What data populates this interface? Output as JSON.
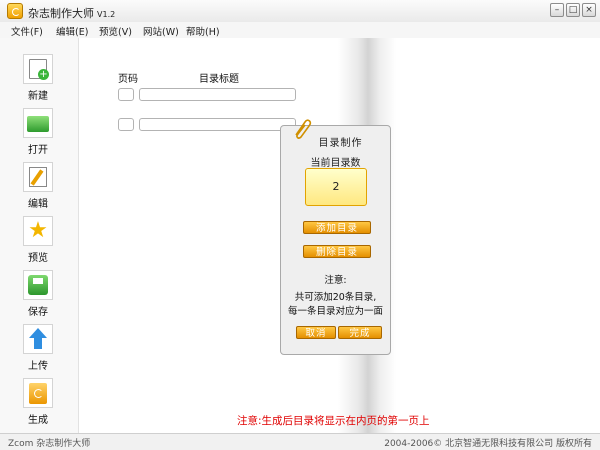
{
  "window": {
    "title": "杂志制作大师",
    "version": "V1.2",
    "minimize": "–",
    "maximize": "□",
    "close": "×"
  },
  "menu": [
    {
      "label": "文件",
      "key": "(F)"
    },
    {
      "label": "编辑",
      "key": "(E)"
    },
    {
      "label": "预览",
      "key": "(V)"
    },
    {
      "label": "网站",
      "key": "(W)"
    },
    {
      "label": "帮助",
      "key": "(H)"
    }
  ],
  "sidebar": [
    {
      "label": "新建",
      "icon": "new-document-icon"
    },
    {
      "label": "打开",
      "icon": "open-folder-icon"
    },
    {
      "label": "编辑",
      "icon": "edit-icon"
    },
    {
      "label": "预览",
      "icon": "preview-star-icon"
    },
    {
      "label": "保存",
      "icon": "save-icon"
    },
    {
      "label": "上传",
      "icon": "upload-arrow-icon"
    },
    {
      "label": "生成",
      "icon": "generate-book-icon"
    }
  ],
  "toc_form": {
    "page_header": "页码",
    "title_header": "目录标题",
    "rows": [
      {
        "page": "",
        "title": ""
      },
      {
        "page": "",
        "title": ""
      }
    ]
  },
  "panel": {
    "title": "目录制作",
    "current_label": "当前目录数",
    "count": "2",
    "add_button": "添加目录",
    "delete_button": "删除目录",
    "note_title": "注意:",
    "note_line1": "共可添加20条目录,",
    "note_line2": "每一条目录对应为一面",
    "cancel_button": "取消",
    "done_button": "完成"
  },
  "notice": "注意:生成后目录将显示在内页的第一页上",
  "status": {
    "left": "Zcom 杂志制作大师",
    "right": "2004-2006© 北京智通无限科技有限公司 版权所有"
  },
  "colors": {
    "accent_orange": "#f0a000",
    "notice_red": "#e00000",
    "count_bg": "#ffe880"
  }
}
